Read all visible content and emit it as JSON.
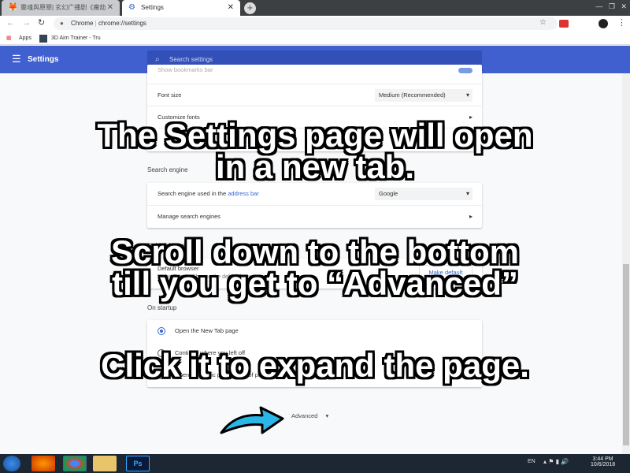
{
  "browser": {
    "tabs": [
      {
        "label": "靈魂與原罪| 玄幻广播剧《魔劫",
        "active": false
      },
      {
        "label": "Settings",
        "active": true
      }
    ],
    "omnibox": {
      "site": "Chrome",
      "url": "chrome://settings"
    },
    "bookmarks": [
      "Apps",
      "3D Aim Trainer - Tru"
    ]
  },
  "settings": {
    "title": "Settings",
    "search_placeholder": "Search settings",
    "appearance_rows": {
      "partial": "Show bookmarks bar",
      "font_size": "Font size",
      "font_size_value": "Medium (Recommended)",
      "customize_fonts": "Customize fonts"
    },
    "search_engine": {
      "label": "Search engine",
      "row1_prefix": "Search engine used in the ",
      "row1_link": "address bar",
      "row1_value": "Google",
      "row2": "Manage search engines"
    },
    "default_browser": {
      "label": "Default browser",
      "title": "Default browser",
      "desc": "Make Google Chrome the default browser",
      "button": "Make default"
    },
    "on_startup": {
      "label": "On startup",
      "options": [
        {
          "label": "Open the New Tab page",
          "checked": true
        },
        {
          "label": "Continue where you left off",
          "checked": false
        },
        {
          "label": "Open a specific page or set of pages",
          "checked": false
        }
      ]
    },
    "advanced": "Advanced"
  },
  "overlay": {
    "line1": "The Settings page will open",
    "line2": "in a new tab.",
    "line3": "Scroll down to the bottom",
    "line4": "till you get to “Advanced”",
    "line5": "Click it to expand the page."
  },
  "taskbar": {
    "lang": "EN",
    "time": "3:44 PM",
    "date": "10/6/2018"
  },
  "colors": {
    "header": "#4060d0",
    "accent": "#3367d6",
    "arrow": "#29b6e8"
  }
}
